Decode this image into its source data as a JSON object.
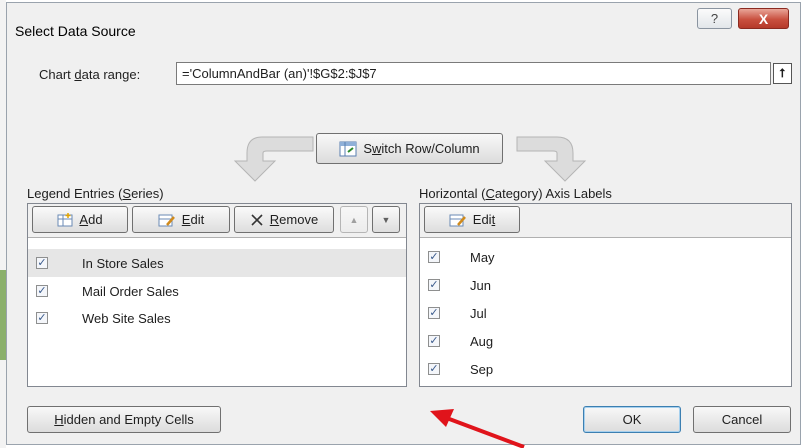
{
  "window": {
    "title": "Select Data Source",
    "help_glyph": "?",
    "close_glyph": "X"
  },
  "data_range": {
    "label_pre": "Chart ",
    "label_accel": "d",
    "label_post": "ata range:",
    "value": "='ColumnAndBar (an)'!$G$2:$J$7",
    "collapse_glyph": "⭡"
  },
  "switch_button": {
    "label_pre": "S",
    "label_accel": "w",
    "label_post": "itch Row/Column"
  },
  "legend": {
    "label_pre": "Legend Entries (",
    "label_accel": "S",
    "label_post": "eries)",
    "add_accel": "A",
    "add_rest": "dd",
    "edit_accel": "E",
    "edit_rest": "dit",
    "remove_accel": "R",
    "remove_rest": "emove",
    "up_glyph": "▲",
    "down_glyph": "▼",
    "items": [
      {
        "label": "In Store Sales",
        "checked": true
      },
      {
        "label": "Mail Order Sales",
        "checked": true
      },
      {
        "label": "Web Site Sales",
        "checked": true
      }
    ]
  },
  "axis": {
    "label_pre": "Horizontal (",
    "label_accel": "C",
    "label_post": "ategory) Axis Labels",
    "edit_pre": "Edi",
    "edit_accel": "t",
    "items": [
      {
        "label": "May",
        "checked": true
      },
      {
        "label": "Jun",
        "checked": true
      },
      {
        "label": "Jul",
        "checked": true
      },
      {
        "label": "Aug",
        "checked": true
      },
      {
        "label": "Sep",
        "checked": true
      }
    ]
  },
  "footer": {
    "hidden_accel": "H",
    "hidden_rest": "idden and Empty Cells",
    "ok_label": "OK",
    "cancel_label": "Cancel"
  },
  "colors": {
    "annotation_arrow": "#e0141b",
    "close_button": "#c9503f"
  },
  "check_glyph": "✓"
}
